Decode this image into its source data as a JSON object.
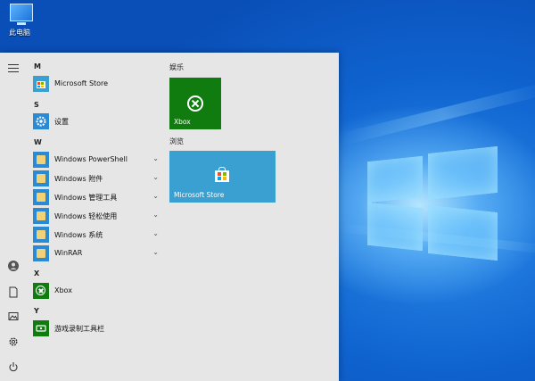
{
  "desktop": {
    "icon_label": "此电脑"
  },
  "rail": {
    "menu": "hamburger-icon",
    "bottom": [
      "user-icon",
      "document-icon",
      "pictures-icon",
      "settings-icon",
      "power-icon"
    ]
  },
  "apps": {
    "headers": {
      "m": "M",
      "s": "S",
      "w": "W",
      "x": "X",
      "y": "Y"
    },
    "ms_store": "Microsoft Store",
    "settings": "设置",
    "powershell": "Windows PowerShell",
    "accessories": "Windows 附件",
    "admin_tools": "Windows 管理工具",
    "ease_access": "Windows 轻松使用",
    "system": "Windows 系统",
    "winrar": "WinRAR",
    "xbox": "Xbox",
    "game_bar": "游戏录制工具栏"
  },
  "tiles": {
    "group_entertainment": "娱乐",
    "group_browse": "浏览",
    "xbox": "Xbox",
    "store": "Microsoft Store"
  },
  "colors": {
    "xbox_green": "#107c10",
    "store_blue": "#3a9fd1",
    "start_bg": "#e6e6e6"
  }
}
